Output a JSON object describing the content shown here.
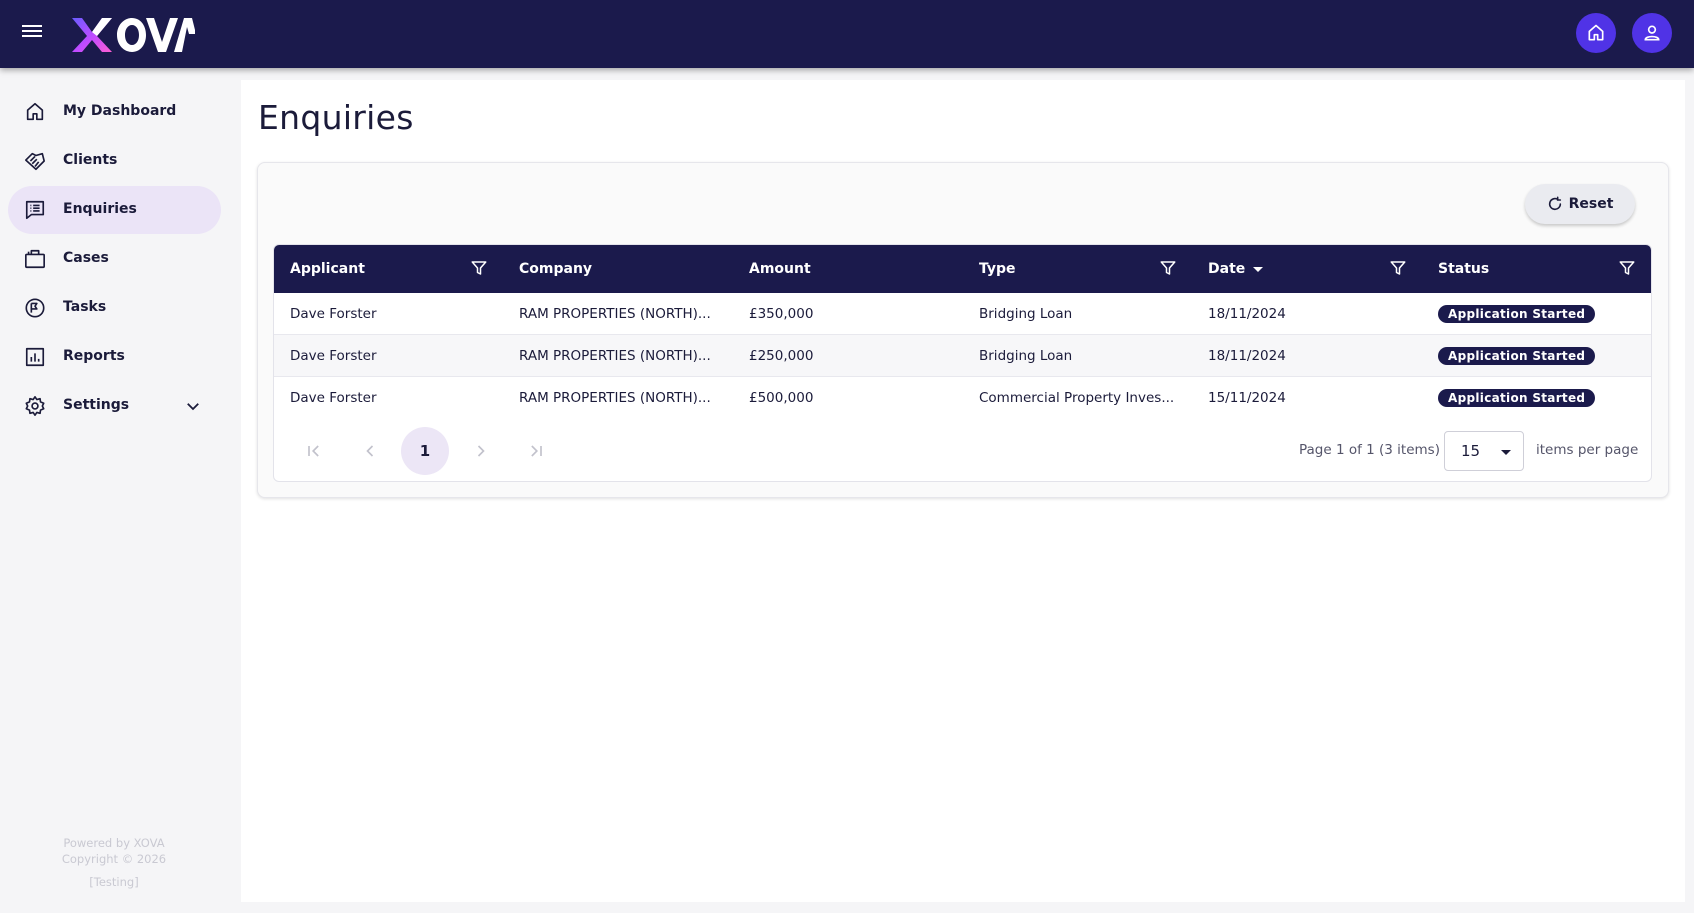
{
  "header": {
    "logo_text": "XOVA",
    "home_button_icon": "home-icon",
    "profile_button_icon": "user-icon"
  },
  "sidebar": {
    "items": [
      {
        "label": "My Dashboard",
        "icon": "home-icon"
      },
      {
        "label": "Clients",
        "icon": "handshake-icon"
      },
      {
        "label": "Enquiries",
        "icon": "list-icon",
        "active": true
      },
      {
        "label": "Cases",
        "icon": "briefcase-icon"
      },
      {
        "label": "Tasks",
        "icon": "tasks-icon"
      },
      {
        "label": "Reports",
        "icon": "bar-chart-icon"
      },
      {
        "label": "Settings",
        "icon": "gear-icon",
        "expandable": true
      }
    ],
    "footer": {
      "powered_by": "Powered by XOVA",
      "copyright": "Copyright © 2026",
      "environment": "[Testing]"
    }
  },
  "main": {
    "title": "Enquiries",
    "reset_label": "Reset",
    "table": {
      "columns": [
        {
          "label": "Applicant",
          "filter": true
        },
        {
          "label": "Company",
          "filter": false
        },
        {
          "label": "Amount",
          "filter": false
        },
        {
          "label": "Type",
          "filter": true
        },
        {
          "label": "Date",
          "filter": true,
          "sorted": "desc"
        },
        {
          "label": "Status",
          "filter": true
        }
      ],
      "rows": [
        {
          "applicant": "Dave Forster",
          "company": "RAM PROPERTIES (NORTH)...",
          "amount": "£350,000",
          "type": "Bridging Loan",
          "date": "18/11/2024",
          "status": "Application Started"
        },
        {
          "applicant": "Dave Forster",
          "company": "RAM PROPERTIES (NORTH)...",
          "amount": "£250,000",
          "type": "Bridging Loan",
          "date": "18/11/2024",
          "status": "Application Started"
        },
        {
          "applicant": "Dave Forster",
          "company": "RAM PROPERTIES (NORTH)...",
          "amount": "£500,000",
          "type": "Commercial Property Inves...",
          "date": "15/11/2024",
          "status": "Application Started"
        }
      ]
    },
    "pager": {
      "current_page": "1",
      "info": "Page 1 of 1 (3 items)",
      "per_page": "15",
      "per_page_label": "items per page"
    }
  },
  "colors": {
    "header_bg": "#1b1a4c",
    "accent": "#5033e6",
    "active_nav_bg": "#ebe4f7"
  }
}
